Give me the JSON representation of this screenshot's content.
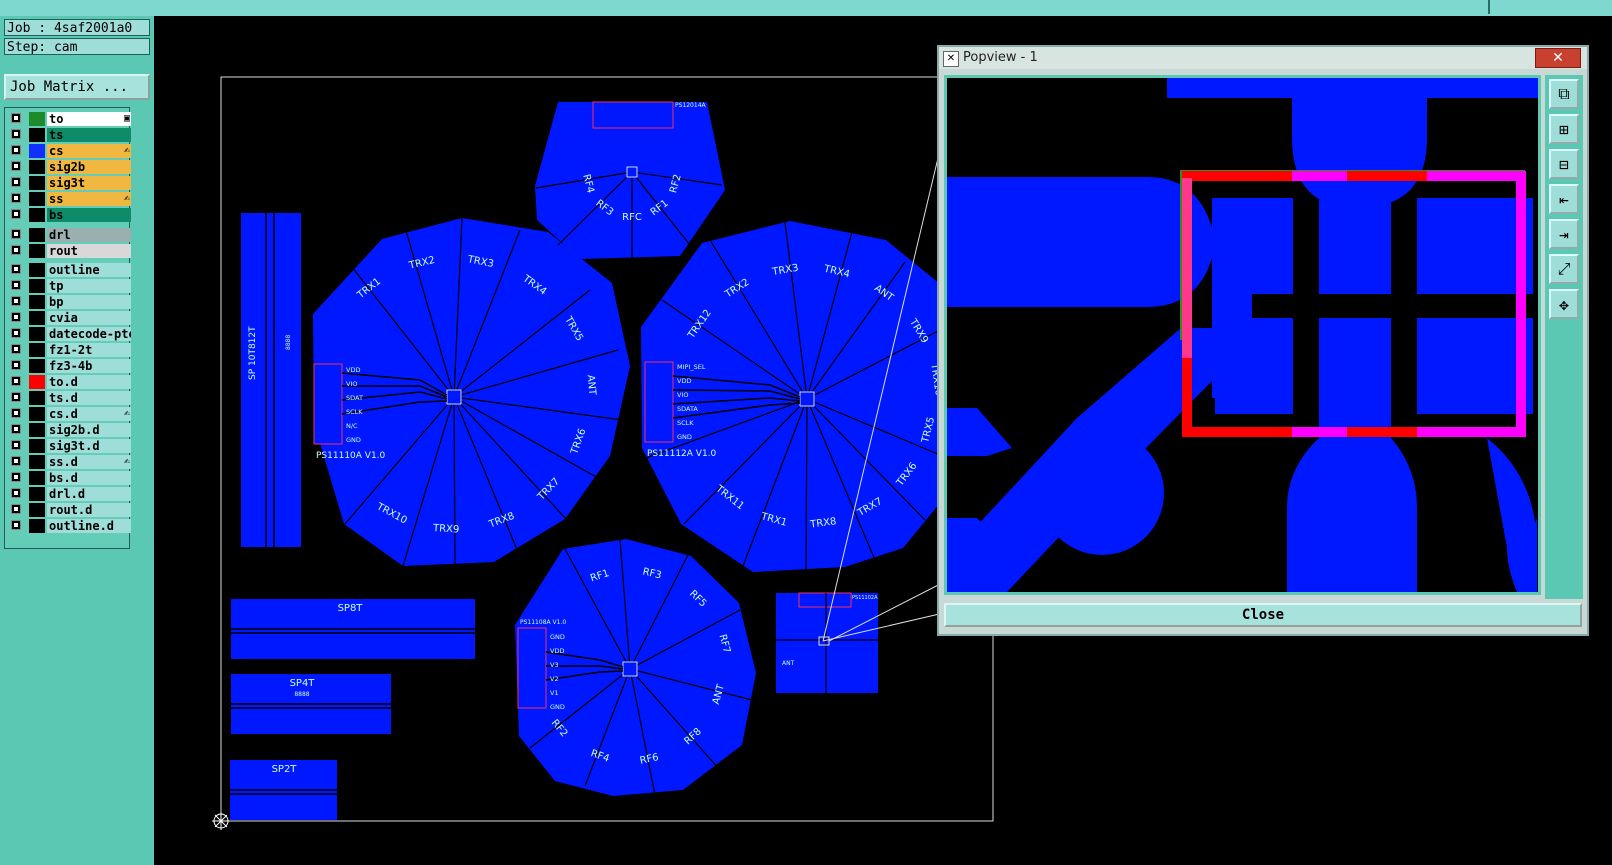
{
  "window": {
    "job_label": "Job : 4saf2001a0",
    "step_label": "Step: cam",
    "job_matrix_button": "Job Matrix ..."
  },
  "colors": {
    "panel": "#5bc8b4",
    "board_copper": "#0018ff",
    "highlight_red": "#ff0000",
    "highlight_magenta": "#ff00ff"
  },
  "layers": [
    {
      "name": "to",
      "swatch": "#1e8a2a",
      "bg": "#ffffff",
      "mark": "▣"
    },
    {
      "name": "ts",
      "swatch": "#000000",
      "bg": "#0e8c6a",
      "mark": ""
    },
    {
      "name": "cs",
      "swatch": "#1030ff",
      "bg": "#f0b840",
      "mark": "✍"
    },
    {
      "name": "sig2b",
      "swatch": "#000000",
      "bg": "#f0b840",
      "mark": ""
    },
    {
      "name": "sig3t",
      "swatch": "#000000",
      "bg": "#f0b840",
      "mark": ""
    },
    {
      "name": "ss",
      "swatch": "#000000",
      "bg": "#f0b840",
      "mark": "✍"
    },
    {
      "name": "bs",
      "swatch": "#000000",
      "bg": "#0e8c6a",
      "mark": ""
    },
    {
      "name": "drl",
      "swatch": "#000000",
      "bg": "#9ab0b0",
      "mark": ""
    },
    {
      "name": "rout",
      "swatch": "#000000",
      "bg": "#d8d8d8",
      "mark": ""
    },
    {
      "name": "outline",
      "swatch": "#000000",
      "bg": "#9fded8",
      "mark": ""
    },
    {
      "name": "tp",
      "swatch": "#000000",
      "bg": "#9fded8",
      "mark": ""
    },
    {
      "name": "bp",
      "swatch": "#000000",
      "bg": "#9fded8",
      "mark": ""
    },
    {
      "name": "cvia",
      "swatch": "#000000",
      "bg": "#9fded8",
      "mark": ""
    },
    {
      "name": "datecode-pte",
      "swatch": "#000000",
      "bg": "#9fded8",
      "mark": ""
    },
    {
      "name": "fz1-2t",
      "swatch": "#000000",
      "bg": "#9fded8",
      "mark": ""
    },
    {
      "name": "fz3-4b",
      "swatch": "#000000",
      "bg": "#9fded8",
      "mark": ""
    },
    {
      "name": "to.d",
      "swatch": "#ff0000",
      "bg": "#9fded8",
      "mark": ""
    },
    {
      "name": "ts.d",
      "swatch": "#000000",
      "bg": "#9fded8",
      "mark": ""
    },
    {
      "name": "cs.d",
      "swatch": "#000000",
      "bg": "#9fded8",
      "mark": "✍"
    },
    {
      "name": "sig2b.d",
      "swatch": "#000000",
      "bg": "#9fded8",
      "mark": ""
    },
    {
      "name": "sig3t.d",
      "swatch": "#000000",
      "bg": "#9fded8",
      "mark": ""
    },
    {
      "name": "ss.d",
      "swatch": "#000000",
      "bg": "#9fded8",
      "mark": "✍"
    },
    {
      "name": "bs.d",
      "swatch": "#000000",
      "bg": "#9fded8",
      "mark": ""
    },
    {
      "name": "drl.d",
      "swatch": "#000000",
      "bg": "#9fded8",
      "mark": ""
    },
    {
      "name": "rout.d",
      "swatch": "#000000",
      "bg": "#9fded8",
      "mark": ""
    },
    {
      "name": "outline.d",
      "swatch": "#000000",
      "bg": "#9fded8",
      "mark": ""
    }
  ],
  "board": {
    "labels": {
      "sp10t": "SP 10T812T",
      "sp8t": "SP8T",
      "sp4t": "SP4T",
      "sp2t": "SP2T",
      "p1_name": "PS11110A V1.0",
      "p2_name": "PS11112A V1.0",
      "p3_name": "PS11108A V1.0",
      "p4_name": "PS12014A",
      "p5_name": "PS11102A",
      "rf_ant": "ANT",
      "code1": "8888"
    },
    "p1_pins": [
      "VDD",
      "VIO",
      "SDAT",
      "SCLK",
      "N/C",
      "GND"
    ],
    "p2_pins": [
      "MIPI_SEL",
      "VDD",
      "VIO",
      "SDATA",
      "SCLK",
      "GND"
    ],
    "p3_pins": [
      "GND",
      "VDD",
      "V3",
      "V2",
      "V1",
      "GND"
    ],
    "p1_rays": [
      "TRX1",
      "TRX2",
      "TRX3",
      "TRX4",
      "TRX5",
      "ANT",
      "TRX6",
      "TRX7",
      "TRX8",
      "TRX9",
      "TRX10"
    ],
    "p2_rays": [
      "TRX12",
      "TRX2",
      "TRX3",
      "TRX4",
      "ANT",
      "TRX9",
      "TRX10",
      "TRX5",
      "TRX6",
      "TRX7",
      "TRX8",
      "TRX1",
      "TRX11"
    ],
    "p3_rays": [
      "RF1",
      "RF3",
      "RF5",
      "RF7",
      "ANT",
      "RF8",
      "RF6",
      "RF4",
      "RF2"
    ],
    "p4_rays": [
      "RF4",
      "RF3",
      "RFC",
      "RF1",
      "RF2"
    ]
  },
  "popview": {
    "title": "Popview - 1",
    "close_label": "Close",
    "tools": [
      "zoom-window-icon",
      "zoom-in-icon",
      "zoom-out-icon",
      "pan-left-icon",
      "pan-right-icon",
      "fit-icon",
      "center-icon"
    ]
  }
}
